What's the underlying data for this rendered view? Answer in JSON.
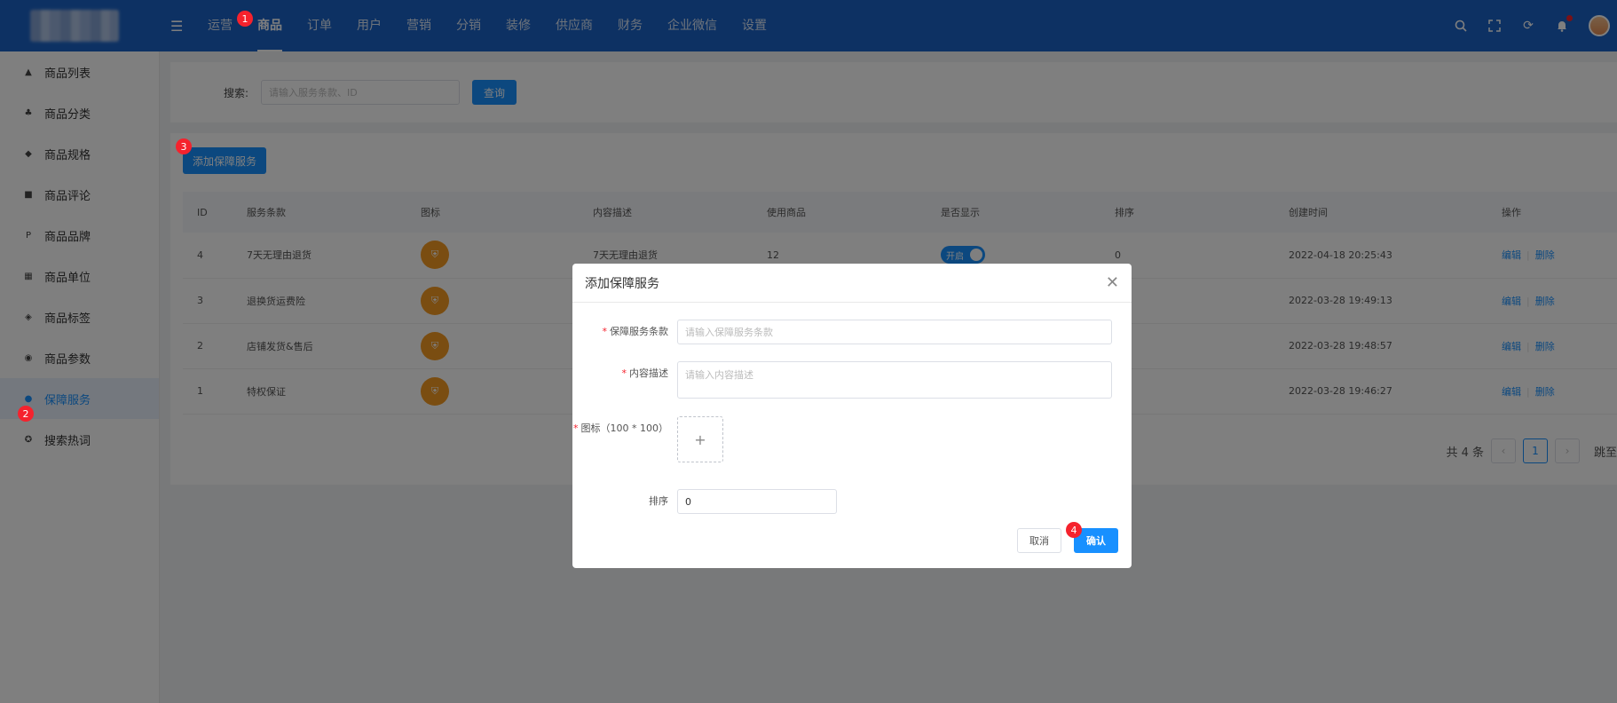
{
  "header": {
    "nav": [
      "运营",
      "商品",
      "订单",
      "用户",
      "营销",
      "分销",
      "装修",
      "供应商",
      "财务",
      "企业微信",
      "设置"
    ],
    "active_nav": "商品"
  },
  "sidebar": {
    "items": [
      "商品列表",
      "商品分类",
      "商品规格",
      "商品评论",
      "商品品牌",
      "商品单位",
      "商品标签",
      "商品参数",
      "保障服务",
      "搜索热词"
    ]
  },
  "search": {
    "label": "搜索:",
    "placeholder": "请输入服务条款、ID",
    "button": "查询"
  },
  "add_button": "添加保障服务",
  "table": {
    "columns": [
      "ID",
      "服务条款",
      "图标",
      "内容描述",
      "使用商品",
      "是否显示",
      "排序",
      "创建时间",
      "操作"
    ],
    "rows": [
      {
        "id": "4",
        "name": "7天无理由退货",
        "desc": "7天无理由退货",
        "usage": "12",
        "show": "开启",
        "sort": "0",
        "created": "2022-04-18 20:25:43"
      },
      {
        "id": "3",
        "name": "退换货运费险",
        "desc": "",
        "usage": "",
        "show": "",
        "sort": "",
        "created": "2022-03-28 19:49:13"
      },
      {
        "id": "2",
        "name": "店铺发货&售后",
        "desc": "",
        "usage": "",
        "show": "",
        "sort": "",
        "created": "2022-03-28 19:48:57"
      },
      {
        "id": "1",
        "name": "特权保证",
        "desc": "",
        "usage": "",
        "show": "",
        "sort": "",
        "created": "2022-03-28 19:46:27"
      }
    ],
    "edit": "编辑",
    "delete": "删除"
  },
  "pagination": {
    "total": "共 4 条",
    "current": "1",
    "jump": "跳至"
  },
  "modal": {
    "title": "添加保障服务",
    "term_label": "保障服务条款",
    "term_placeholder": "请输入保障服务条款",
    "desc_label": "内容描述",
    "desc_placeholder": "请输入内容描述",
    "icon_label": "图标（100 * 100）",
    "sort_label": "排序",
    "sort_value": "0",
    "cancel": "取消",
    "confirm": "确认"
  },
  "badges": [
    "1",
    "2",
    "3",
    "4"
  ],
  "colors": {
    "primary": "#1890ff",
    "header": "#1b63c7",
    "danger": "#f5222d",
    "icon_bg": "#f59a23"
  }
}
